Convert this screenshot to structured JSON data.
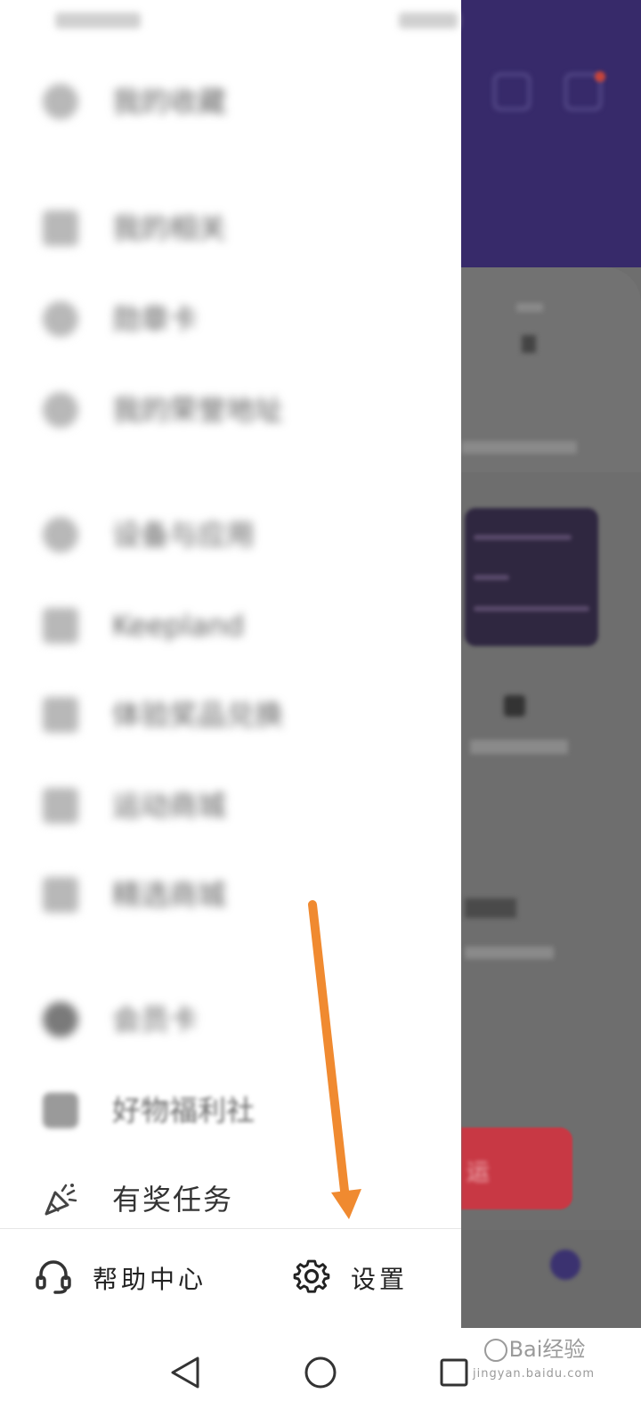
{
  "drawer": {
    "menu_items": [
      {
        "label": "我的收藏",
        "icon": "star-icon",
        "state": "blurred"
      },
      {
        "label": "我的相关",
        "icon": "list-icon",
        "state": "blurred"
      },
      {
        "label": "勋章卡",
        "icon": "medal-icon",
        "state": "blurred"
      },
      {
        "label": "我的荣誉地址",
        "icon": "location-icon",
        "state": "blurred"
      },
      {
        "label": "设备与应用",
        "icon": "device-icon",
        "state": "blurred"
      },
      {
        "label": "Keepland",
        "icon": "building-icon",
        "state": "blurred"
      },
      {
        "label": "体验奖品兑换",
        "icon": "gift-icon",
        "state": "blurred"
      },
      {
        "label": "运动商城",
        "icon": "store-icon",
        "state": "blurred"
      },
      {
        "label": "精选商城",
        "icon": "cart-icon",
        "state": "blurred"
      },
      {
        "label": "会员卡",
        "icon": "vip-icon",
        "state": "blurred"
      },
      {
        "label": "好物福利社",
        "icon": "welfare-icon",
        "state": "semi"
      },
      {
        "label": "有奖任务",
        "icon": "party-popper-icon",
        "state": "sharp"
      }
    ],
    "bottom_bar": {
      "help_label": "帮助中心",
      "settings_label": "设置"
    }
  },
  "background_app": {
    "cta_label": "运"
  },
  "watermark": {
    "brand": "Bai经验",
    "url": "jingyan.baidu.com"
  },
  "colors": {
    "header_purple": "#372a6a",
    "cta_red": "#c83844",
    "annotation_arrow": "#f08a30"
  }
}
